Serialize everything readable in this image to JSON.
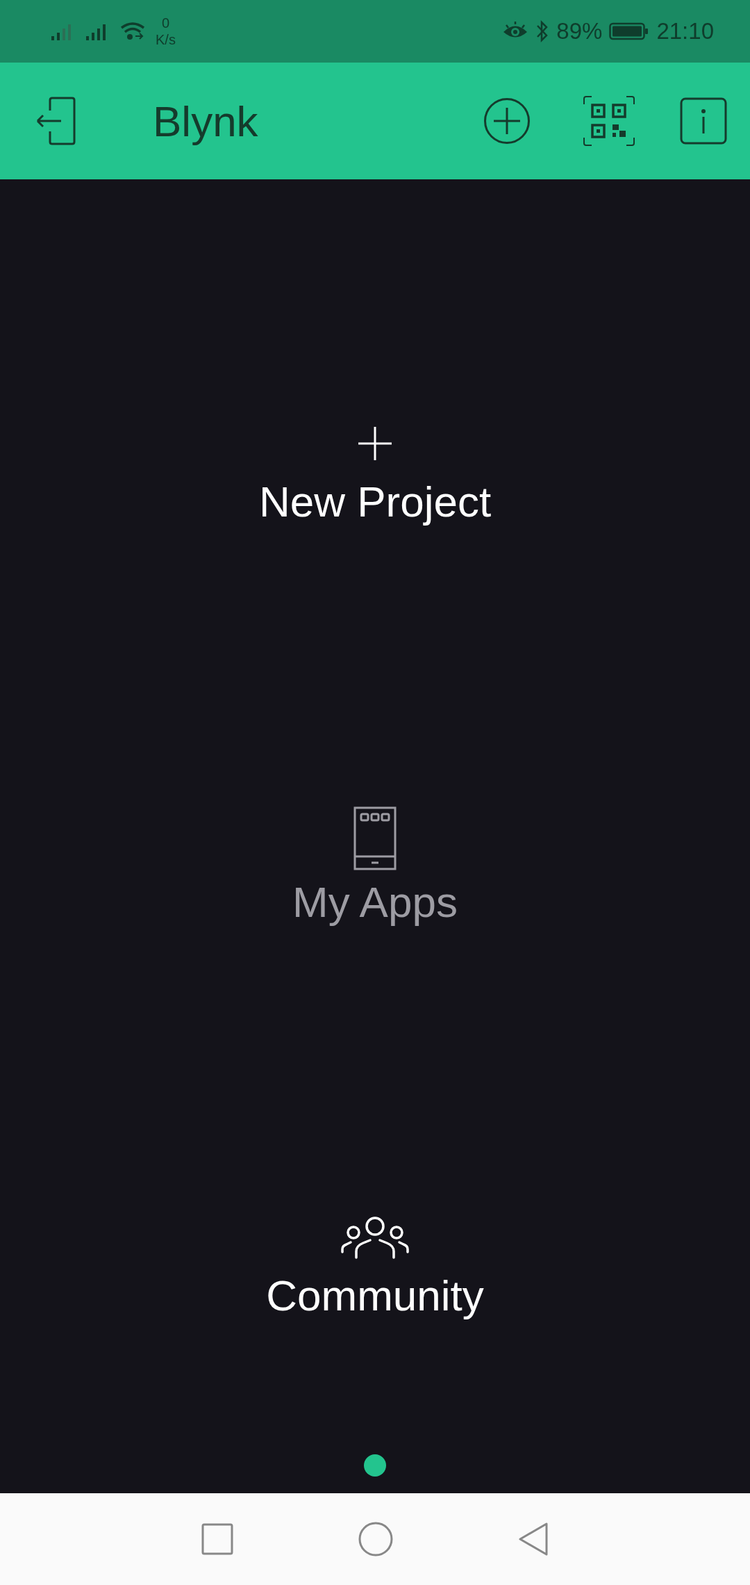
{
  "status_bar": {
    "net_speed_value": "0",
    "net_speed_unit": "K/s",
    "battery": "89%",
    "time": "21:10"
  },
  "header": {
    "title": "Blynk"
  },
  "menu": [
    {
      "kind": "plus",
      "label": "New Project",
      "disabled": false
    },
    {
      "kind": "phone",
      "label": "My Apps",
      "disabled": true
    },
    {
      "kind": "people",
      "label": "Community",
      "disabled": false
    }
  ],
  "page_indicator": [
    {
      "selected": true
    }
  ]
}
